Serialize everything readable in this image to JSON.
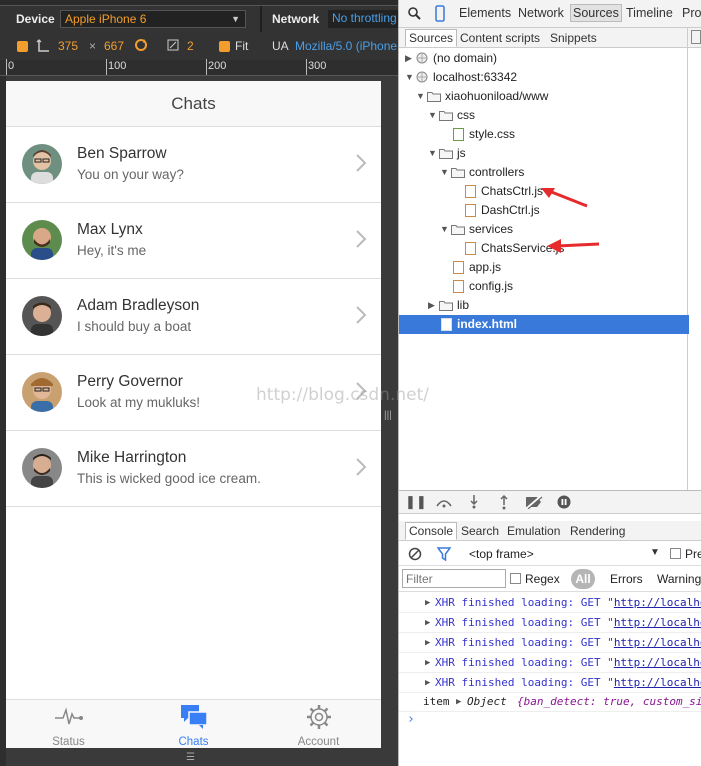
{
  "device_toolbar": {
    "device_label": "Device",
    "device_value": "Apple iPhone 6",
    "network_label": "Network",
    "network_value": "No throttling",
    "width": "375",
    "times": "×",
    "height": "667",
    "scale": "2",
    "fit_label": "Fit",
    "ua_label": "UA",
    "ua_value": "Mozilla/5.0 (iPhone"
  },
  "ruler": {
    "marks": [
      "0",
      "100",
      "200",
      "300"
    ]
  },
  "app": {
    "title": "Chats",
    "chats": [
      {
        "name": "Ben Sparrow",
        "last": "You on your way?"
      },
      {
        "name": "Max Lynx",
        "last": "Hey, it's me"
      },
      {
        "name": "Adam Bradleyson",
        "last": "I should buy a boat"
      },
      {
        "name": "Perry Governor",
        "last": "Look at my mukluks!"
      },
      {
        "name": "Mike Harrington",
        "last": "This is wicked good ice cream."
      }
    ],
    "tabs": [
      {
        "label": "Status",
        "icon": "pulse-icon"
      },
      {
        "label": "Chats",
        "icon": "chat-bubbles-icon"
      },
      {
        "label": "Account",
        "icon": "gear-icon"
      }
    ],
    "accent": "#387ef5"
  },
  "devtools": {
    "tabs": [
      "Elements",
      "Network",
      "Sources",
      "Timeline",
      "Profi"
    ],
    "selected_tab": "Sources",
    "sources_subtabs": [
      "Sources",
      "Content scripts",
      "Snippets"
    ],
    "tree": [
      "(no domain)",
      "localhost:63342",
      "xiaohuoniload/www",
      "css",
      "style.css",
      "js",
      "controllers",
      "ChatsCtrl.js",
      "DashCtrl.js",
      "services",
      "ChatsService.js",
      "app.js",
      "config.js",
      "lib",
      "index.html"
    ],
    "selected_file": "index.html"
  },
  "console": {
    "tabs": [
      "Console",
      "Search",
      "Emulation",
      "Rendering"
    ],
    "frame": "<top frame>",
    "preserve_label": "Pre",
    "filter_placeholder": "Filter",
    "regex_label": "Regex",
    "all_label": "All",
    "errors_label": "Errors",
    "warnings_label": "Warning",
    "logs": [
      {
        "prefix": "XHR finished loading: GET \"",
        "url": "http://localho"
      },
      {
        "prefix": "XHR finished loading: GET \"",
        "url": "http://localho"
      },
      {
        "prefix": "XHR finished loading: GET \"",
        "url": "http://localho"
      },
      {
        "prefix": "XHR finished loading: GET \"",
        "url": "http://localho"
      },
      {
        "prefix": "XHR finished loading: GET \"",
        "url": "http://localho"
      }
    ],
    "object_line": {
      "item": "item",
      "object_label": "Object",
      "content": "{ban_detect: true, custom_si"
    },
    "prompt": "›"
  },
  "watermark": "http://blog.csdn.net/"
}
